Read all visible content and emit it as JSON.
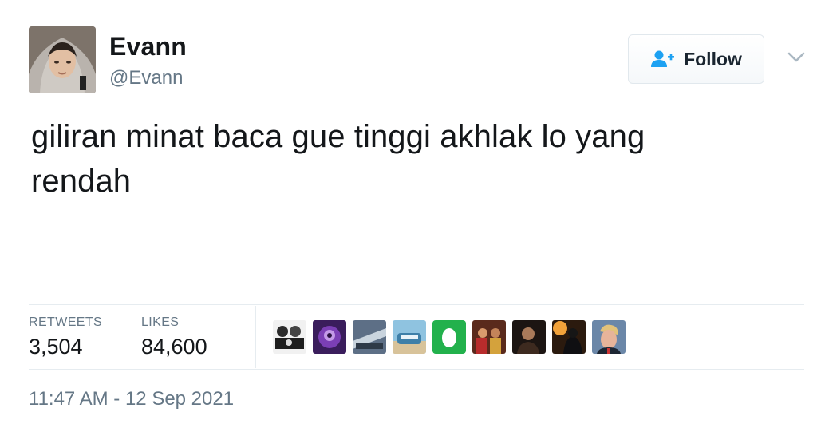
{
  "user": {
    "display_name": "Evann",
    "handle": "@Evann",
    "avatar_icon": "profile-photo"
  },
  "follow_button": {
    "label": "Follow",
    "icon": "add-user-icon",
    "icon_color": "#1da1f2"
  },
  "menu": {
    "icon": "chevron-down-icon"
  },
  "tweet": {
    "text": "giliran minat baca gue tinggi akhlak lo yang rendah"
  },
  "stats": {
    "retweets_label": "RETWEETS",
    "retweets_value": "3,504",
    "likes_label": "LIKES",
    "likes_value": "84,600"
  },
  "likers": [
    {
      "icon": "liker-avatar-1"
    },
    {
      "icon": "liker-avatar-2"
    },
    {
      "icon": "liker-avatar-3"
    },
    {
      "icon": "liker-avatar-4"
    },
    {
      "icon": "liker-avatar-5"
    },
    {
      "icon": "liker-avatar-6"
    },
    {
      "icon": "liker-avatar-7"
    },
    {
      "icon": "liker-avatar-8"
    },
    {
      "icon": "liker-avatar-9"
    }
  ],
  "timestamp": "11:47 AM - 12 Sep 2021",
  "colors": {
    "text_primary": "#14171a",
    "text_secondary": "#657786",
    "accent": "#1da1f2",
    "divider": "#e6ecf0"
  }
}
